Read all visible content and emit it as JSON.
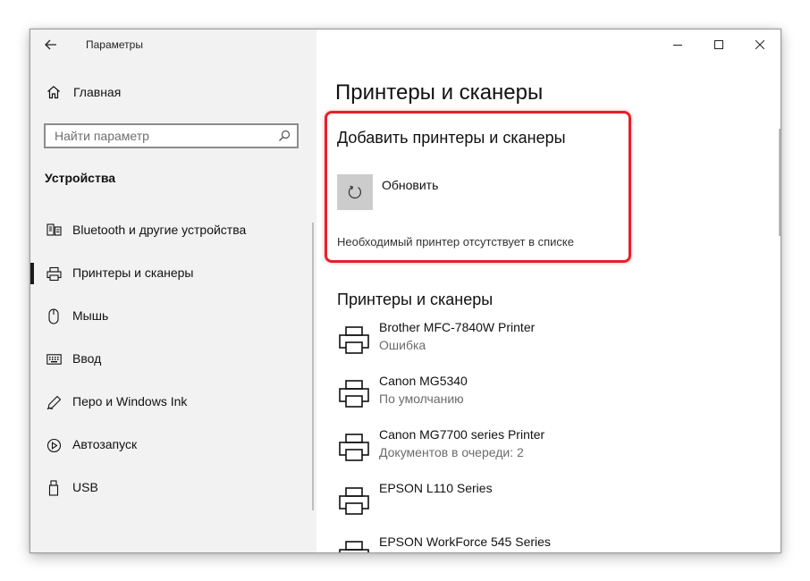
{
  "window": {
    "title": "Параметры",
    "controls": {
      "minimize": "minimize",
      "maximize": "maximize",
      "close": "close"
    }
  },
  "sidebar": {
    "home_label": "Главная",
    "search_placeholder": "Найти параметр",
    "section_title": "Устройства",
    "items": [
      {
        "label": "Bluetooth и другие устройства",
        "icon": "bluetooth-devices-icon"
      },
      {
        "label": "Принтеры и сканеры",
        "icon": "printer-icon",
        "selected": true
      },
      {
        "label": "Мышь",
        "icon": "mouse-icon"
      },
      {
        "label": "Ввод",
        "icon": "keyboard-icon"
      },
      {
        "label": "Перо и Windows Ink",
        "icon": "pen-icon"
      },
      {
        "label": "Автозапуск",
        "icon": "autoplay-icon"
      },
      {
        "label": "USB",
        "icon": "usb-icon"
      }
    ]
  },
  "main": {
    "page_title": "Принтеры и сканеры",
    "add_section": {
      "title": "Добавить принтеры и сканеры",
      "refresh_label": "Обновить",
      "missing_link": "Необходимый принтер отсутствует в списке"
    },
    "printers_section_title": "Принтеры и сканеры",
    "printers": [
      {
        "name": "Brother MFC-7840W Printer",
        "status": "Ошибка"
      },
      {
        "name": "Canon MG5340",
        "status": "По умолчанию"
      },
      {
        "name": "Canon MG7700 series Printer",
        "status": "Документов в очереди: 2"
      },
      {
        "name": "EPSON L110 Series",
        "status": ""
      },
      {
        "name": "EPSON WorkForce 545 Series",
        "status": ""
      }
    ]
  },
  "colors": {
    "highlight": "#e3222a",
    "sidebar_bg": "#f2f2f2",
    "tile_bg": "#cccccc"
  }
}
